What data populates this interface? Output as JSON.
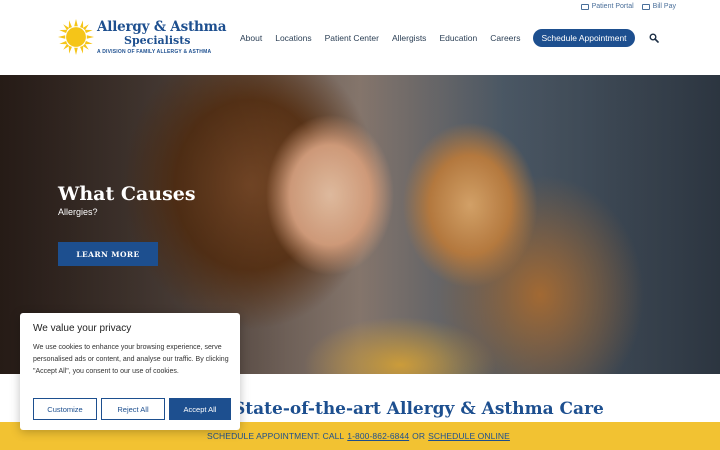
{
  "utility": {
    "patient_portal": "Patient Portal",
    "bill_pay": "Bill Pay"
  },
  "logo": {
    "title": "Allergy & Asthma",
    "subtitle": "Specialists",
    "tagline": "A DIVISION OF FAMILY ALLERGY & ASTHMA"
  },
  "nav": {
    "items": [
      "About",
      "Locations",
      "Patient Center",
      "Allergists",
      "Education",
      "Careers"
    ],
    "cta": "Schedule Appointment",
    "search_icon": "search-icon"
  },
  "hero": {
    "title": "What Causes",
    "subtitle": "Allergies?",
    "button": "LEARN MORE"
  },
  "section": {
    "title": "State-of-the-art Allergy & Asthma Care"
  },
  "bottom_bar": {
    "prefix": "SCHEDULE APPOINTMENT: CALL",
    "phone": "1-800-862-6844",
    "middle": "OR",
    "online": "SCHEDULE ONLINE"
  },
  "cookie": {
    "title": "We value your privacy",
    "body": "We use cookies to enhance your browsing experience, serve personalised ads or content, and analyse our traffic. By clicking \"Accept All\", you consent to our use of cookies.",
    "customize": "Customize",
    "reject": "Reject All",
    "accept": "Accept All"
  },
  "colors": {
    "brand_blue": "#1d4f8f",
    "sun_yellow": "#f5c518",
    "bar_yellow": "#f2c232"
  }
}
